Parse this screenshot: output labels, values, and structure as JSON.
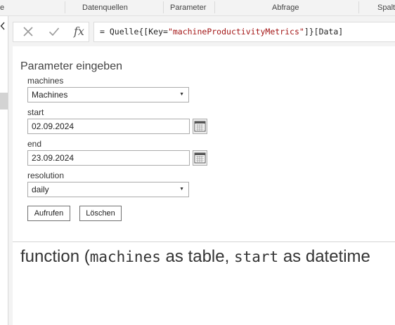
{
  "ribbon": {
    "groups": [
      "e",
      "Datenquellen",
      "Parameter",
      "Abfrage",
      "Spalt"
    ]
  },
  "formula_bar": {
    "cancel_icon": "x-icon",
    "commit_icon": "check-icon",
    "fx_label": "fx",
    "formula_prefix": "= Quelle{[Key=",
    "formula_string": "\"machineProductivityMetrics\"",
    "formula_suffix": "]}[Data]"
  },
  "params": {
    "title": "Parameter eingeben",
    "machines": {
      "label": "machines",
      "value": "Machines"
    },
    "start": {
      "label": "start",
      "value": "02.09.2024"
    },
    "end": {
      "label": "end",
      "value": "23.09.2024"
    },
    "resolution": {
      "label": "resolution",
      "value": "daily"
    }
  },
  "buttons": {
    "invoke": "Aufrufen",
    "clear": "Löschen"
  },
  "signature": {
    "p1": "function (",
    "m1": "machines",
    "p2": " as table, ",
    "m2": "start",
    "p3": " as datetime"
  }
}
